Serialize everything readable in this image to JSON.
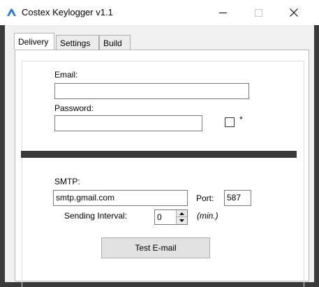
{
  "window": {
    "title": "Costex Keylogger v1.1",
    "icon": "cloud-icon",
    "controls": {
      "minimize": "minimize-icon",
      "maximize": "maximize-icon",
      "close": "close-icon"
    }
  },
  "tabs": [
    {
      "label": "Delivery",
      "active": true
    },
    {
      "label": "Settings",
      "active": false
    },
    {
      "label": "Build",
      "active": false
    }
  ],
  "delivery": {
    "email_label": "Email:",
    "email_value": "",
    "password_label": "Password:",
    "password_value": "",
    "show_password_checked": false,
    "show_password_label": "*",
    "smtp_label": "SMTP:",
    "smtp_value": "smtp.gmail.com",
    "port_label": "Port:",
    "port_value": "587",
    "interval_label": "Sending Interval:",
    "interval_value": "0",
    "interval_unit": "(min.)",
    "test_button": "Test E-mail"
  },
  "colors": {
    "frame": "#3a3a3a",
    "icon_blue": "#2f7fd1"
  }
}
